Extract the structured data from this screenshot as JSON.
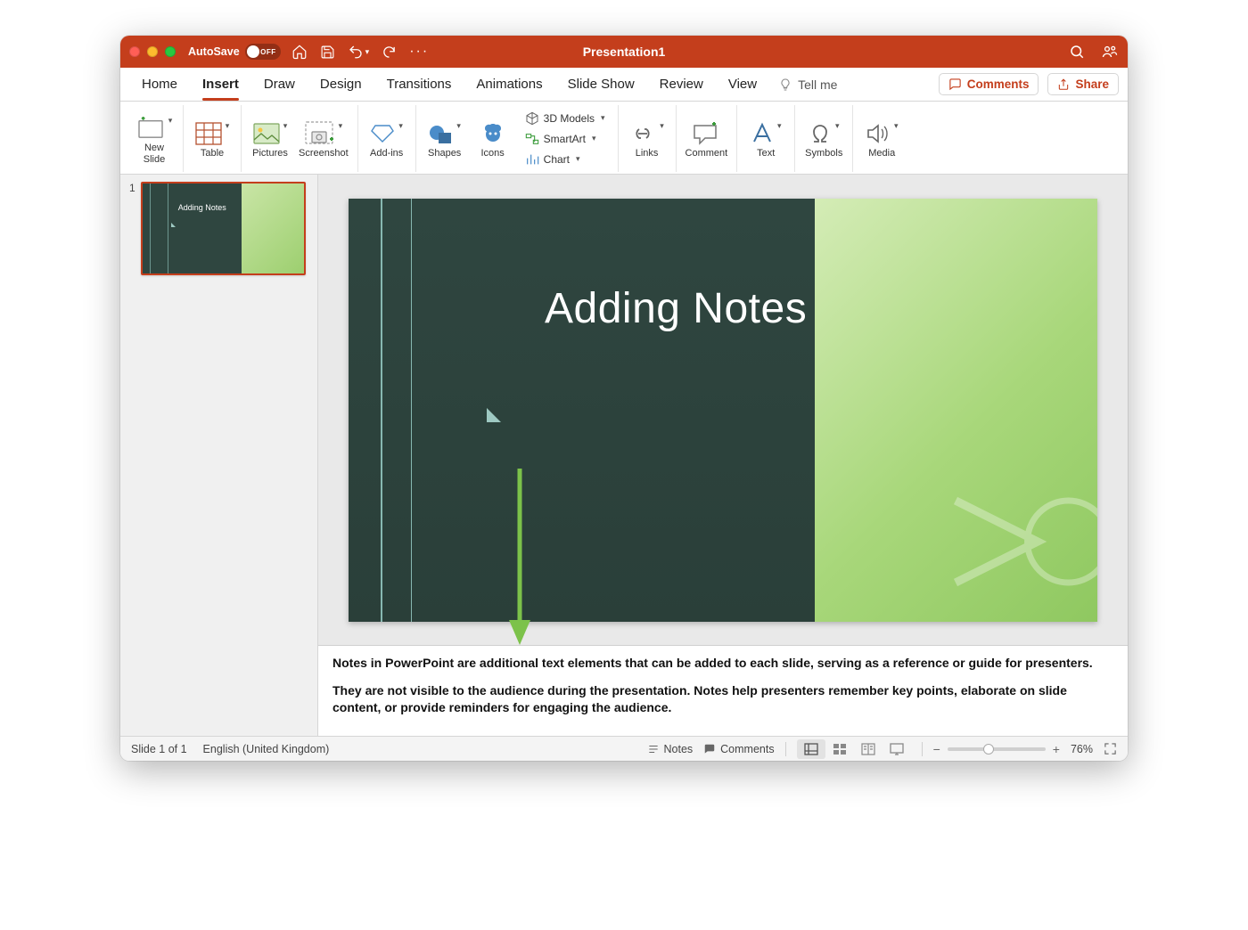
{
  "titlebar": {
    "autosave_label": "AutoSave",
    "autosave_state": "OFF",
    "title": "Presentation1"
  },
  "tabs": {
    "items": [
      "Home",
      "Insert",
      "Draw",
      "Design",
      "Transitions",
      "Animations",
      "Slide Show",
      "Review",
      "View"
    ],
    "active_index": 1,
    "tellme": "Tell me",
    "comments": "Comments",
    "share": "Share"
  },
  "ribbon": {
    "new_slide": "New\nSlide",
    "table": "Table",
    "pictures": "Pictures",
    "screenshot": "Screenshot",
    "addins": "Add-ins",
    "shapes": "Shapes",
    "icons": "Icons",
    "models3d": "3D Models",
    "smartart": "SmartArt",
    "chart": "Chart",
    "links": "Links",
    "comment": "Comment",
    "text": "Text",
    "symbols": "Symbols",
    "media": "Media"
  },
  "thumb": {
    "number": "1",
    "title": "Adding Notes"
  },
  "slide": {
    "title": "Adding Notes"
  },
  "notes": {
    "p1": "Notes in PowerPoint are additional text elements that can be added to each slide, serving as a reference or guide for presenters.",
    "p2": "They are not visible to the audience during the presentation. Notes help presenters remember key points, elaborate on slide content, or provide reminders for engaging the audience."
  },
  "status": {
    "slide_counter": "Slide 1 of 1",
    "language": "English (United Kingdom)",
    "notes_btn": "Notes",
    "comments_btn": "Comments",
    "zoom": "76%"
  }
}
